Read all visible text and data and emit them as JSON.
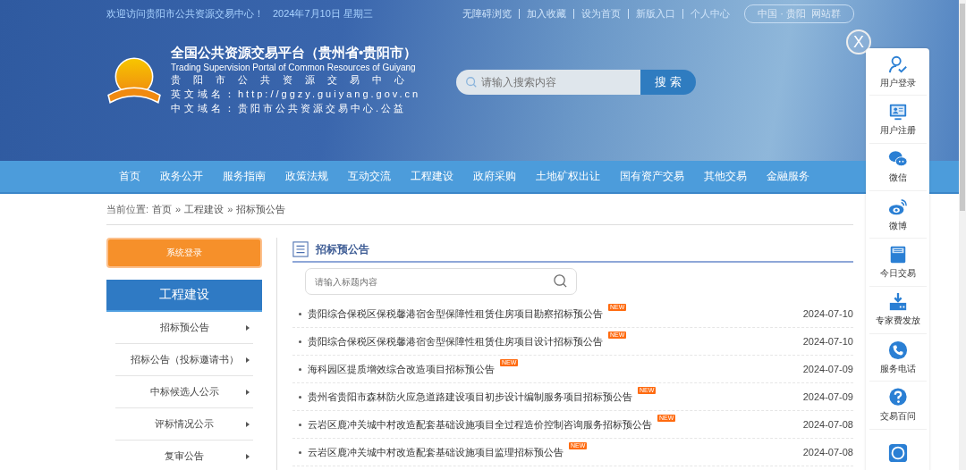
{
  "top_bar": {
    "welcome": "欢迎访问贵阳市公共资源交易中心！",
    "date": "2024年7月10日 星期三",
    "links": [
      "无障碍浏览",
      "加入收藏",
      "设为首页",
      "新版入口",
      "个人中心"
    ],
    "site_group": "中国 · 贵阳  网站群"
  },
  "header": {
    "title": "全国公共资源交易平台（贵州省•贵阳市）",
    "subtitle_en": "Trading Supervision Portal of Common Resources of Guiyang",
    "name_cn": "贵阳市公共资源交易中心",
    "en_domain_label": "英文域名：",
    "en_domain": "http://ggzy.guiyang.gov.cn",
    "cn_domain_label": "中文域名：",
    "cn_domain": "贵阳市公共资源交易中心.公益"
  },
  "search": {
    "placeholder": "请输入搜索内容",
    "button": "搜 索"
  },
  "nav": [
    "首页",
    "政务公开",
    "服务指南",
    "政策法规",
    "互动交流",
    "工程建设",
    "政府采购",
    "土地矿权出让",
    "国有资产交易",
    "其他交易",
    "金融服务"
  ],
  "breadcrumb": {
    "label": "当前位置:",
    "separator": "»",
    "items": [
      "首页",
      "工程建设",
      "招标预公告"
    ]
  },
  "sidebar": {
    "login_button": "系统登录",
    "section_title": "工程建设",
    "menu": [
      "招标预公告",
      "招标公告（投标邀请书）",
      "中标候选人公示",
      "评标情况公示",
      "复审公告"
    ]
  },
  "content": {
    "title": "招标预公告",
    "filter_placeholder": "请输入标题内容",
    "rows": [
      {
        "title": "贵阳综合保税区保税馨港宿舍型保障性租赁住房项目勘察招标预公告",
        "date": "2024-07-10",
        "badge": "NEW"
      },
      {
        "title": "贵阳综合保税区保税馨港宿舍型保障性租赁住房项目设计招标预公告",
        "date": "2024-07-10",
        "badge": "NEW"
      },
      {
        "title": "海科园区提质增效综合改造项目招标预公告",
        "date": "2024-07-09",
        "badge": "NEW"
      },
      {
        "title": "贵州省贵阳市森林防火应急道路建设项目初步设计编制服务项目招标预公告",
        "date": "2024-07-09",
        "badge": "NEW"
      },
      {
        "title": "云岩区鹿冲关城中村改造配套基础设施项目全过程造价控制咨询服务招标预公告",
        "date": "2024-07-08",
        "badge": "NEW"
      },
      {
        "title": "云岩区鹿冲关城中村改造配套基础设施项目监理招标预公告",
        "date": "2024-07-08",
        "badge": "NEW"
      }
    ]
  },
  "float_bar": {
    "close": "X",
    "items": [
      {
        "kind": "user",
        "label": "用户登录"
      },
      {
        "kind": "register",
        "label": "用户注册"
      },
      {
        "kind": "chat",
        "label": "微信"
      },
      {
        "kind": "swirl",
        "label": "微博"
      },
      {
        "kind": "doc",
        "label": "今日交易"
      },
      {
        "kind": "download",
        "label": "专家费发放"
      },
      {
        "kind": "phone",
        "label": "服务电话"
      },
      {
        "kind": "help",
        "label": "交易百问"
      },
      {
        "kind": "badge"
      }
    ]
  }
}
